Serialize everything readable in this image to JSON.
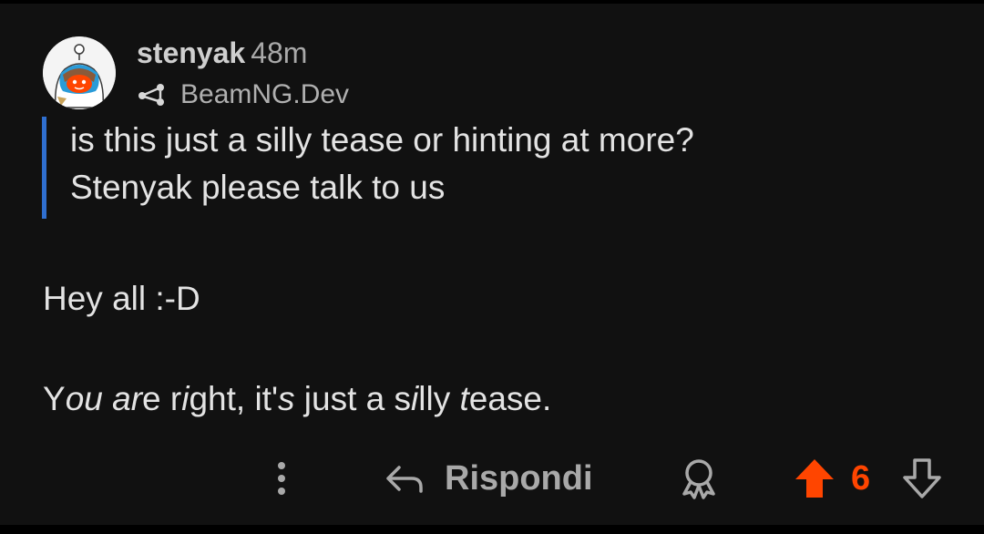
{
  "comment": {
    "author": "stenyak",
    "age": "48m",
    "flair": "BeamNG.Dev",
    "avatar_icon": "snoo-avatar-icon",
    "quote_lines": [
      "is this just a silly tease or hinting at more?",
      "Stenyak please talk to us"
    ],
    "body_lines": [
      "Hey all :-D"
    ],
    "body_line_2": {
      "s1": "Y",
      "s2": "ou a",
      "s3": "r",
      "s4": "e r",
      "s5": "i",
      "s6": "ght, it'",
      "s7": "s",
      "s8": " just a s",
      "s9": "i",
      "s10": "lly ",
      "s11": "t",
      "s12": "ease."
    }
  },
  "actions": {
    "more_icon": "more-vertical-icon",
    "reply_icon": "reply-arrow-icon",
    "reply_label": "Rispondi",
    "award_icon": "award-icon",
    "upvote_icon": "upvote-arrow-icon",
    "score": "6",
    "downvote_icon": "downvote-arrow-icon"
  },
  "colors": {
    "background": "#111111",
    "text": "#e3e3e3",
    "muted_text": "#a9a9a9",
    "quote_bar": "#2f6fd0",
    "upvote_active": "#ff4500"
  }
}
